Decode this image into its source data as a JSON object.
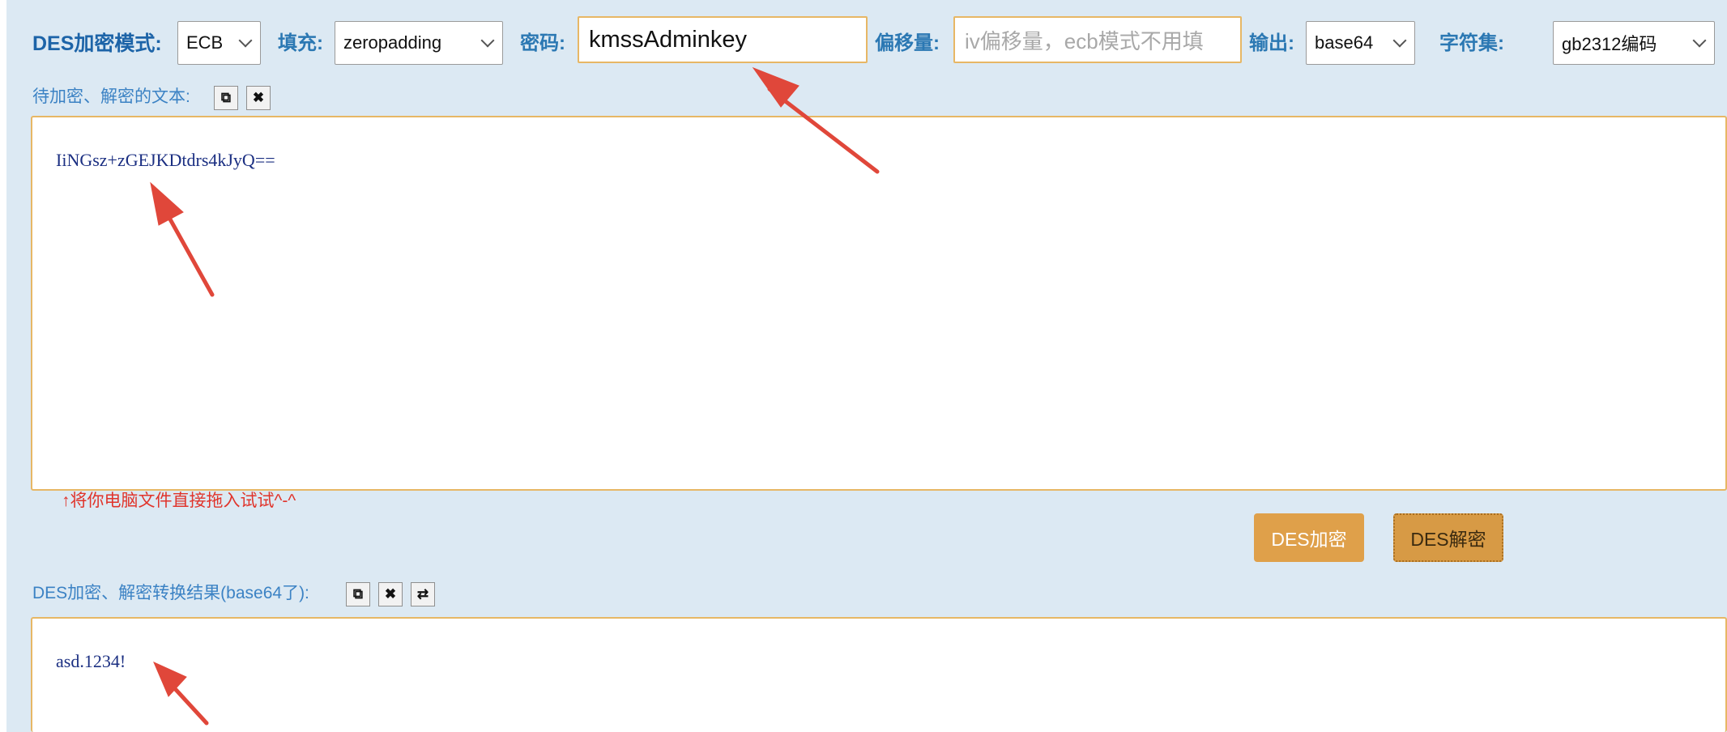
{
  "toolbar": {
    "mode_label": "DES加密模式:",
    "mode_value": "ECB",
    "padding_label": "填充:",
    "padding_value": "zeropadding",
    "key_label": "密码:",
    "key_value": "kmssAdminkey",
    "iv_label": "偏移量:",
    "iv_placeholder": "iv偏移量，ecb模式不用填",
    "output_label": "输出:",
    "output_value": "base64",
    "charset_label": "字符集:",
    "charset_value": "gb2312编码"
  },
  "input_section": {
    "label": "待加密、解密的文本:",
    "text": "IiNGsz+zGEJKDtdrs4kJyQ==",
    "hint": "↑将你电脑文件直接拖入试试^-^"
  },
  "actions": {
    "encrypt_label": "DES加密",
    "decrypt_label": "DES解密"
  },
  "output_section": {
    "label": "DES加密、解密转换结果(base64了):",
    "text": "asd.1234!"
  },
  "icons": {
    "copy": "copy-icon",
    "clear": "clear-icon",
    "swap": "swap-icon"
  },
  "colors": {
    "panel_bg": "#dce9f3",
    "accent_border": "#e7b765",
    "button_orange": "#dfa04a",
    "label_blue": "#2b78b3",
    "hint_red": "#e0342b",
    "annotation_arrow": "#e0473a"
  }
}
